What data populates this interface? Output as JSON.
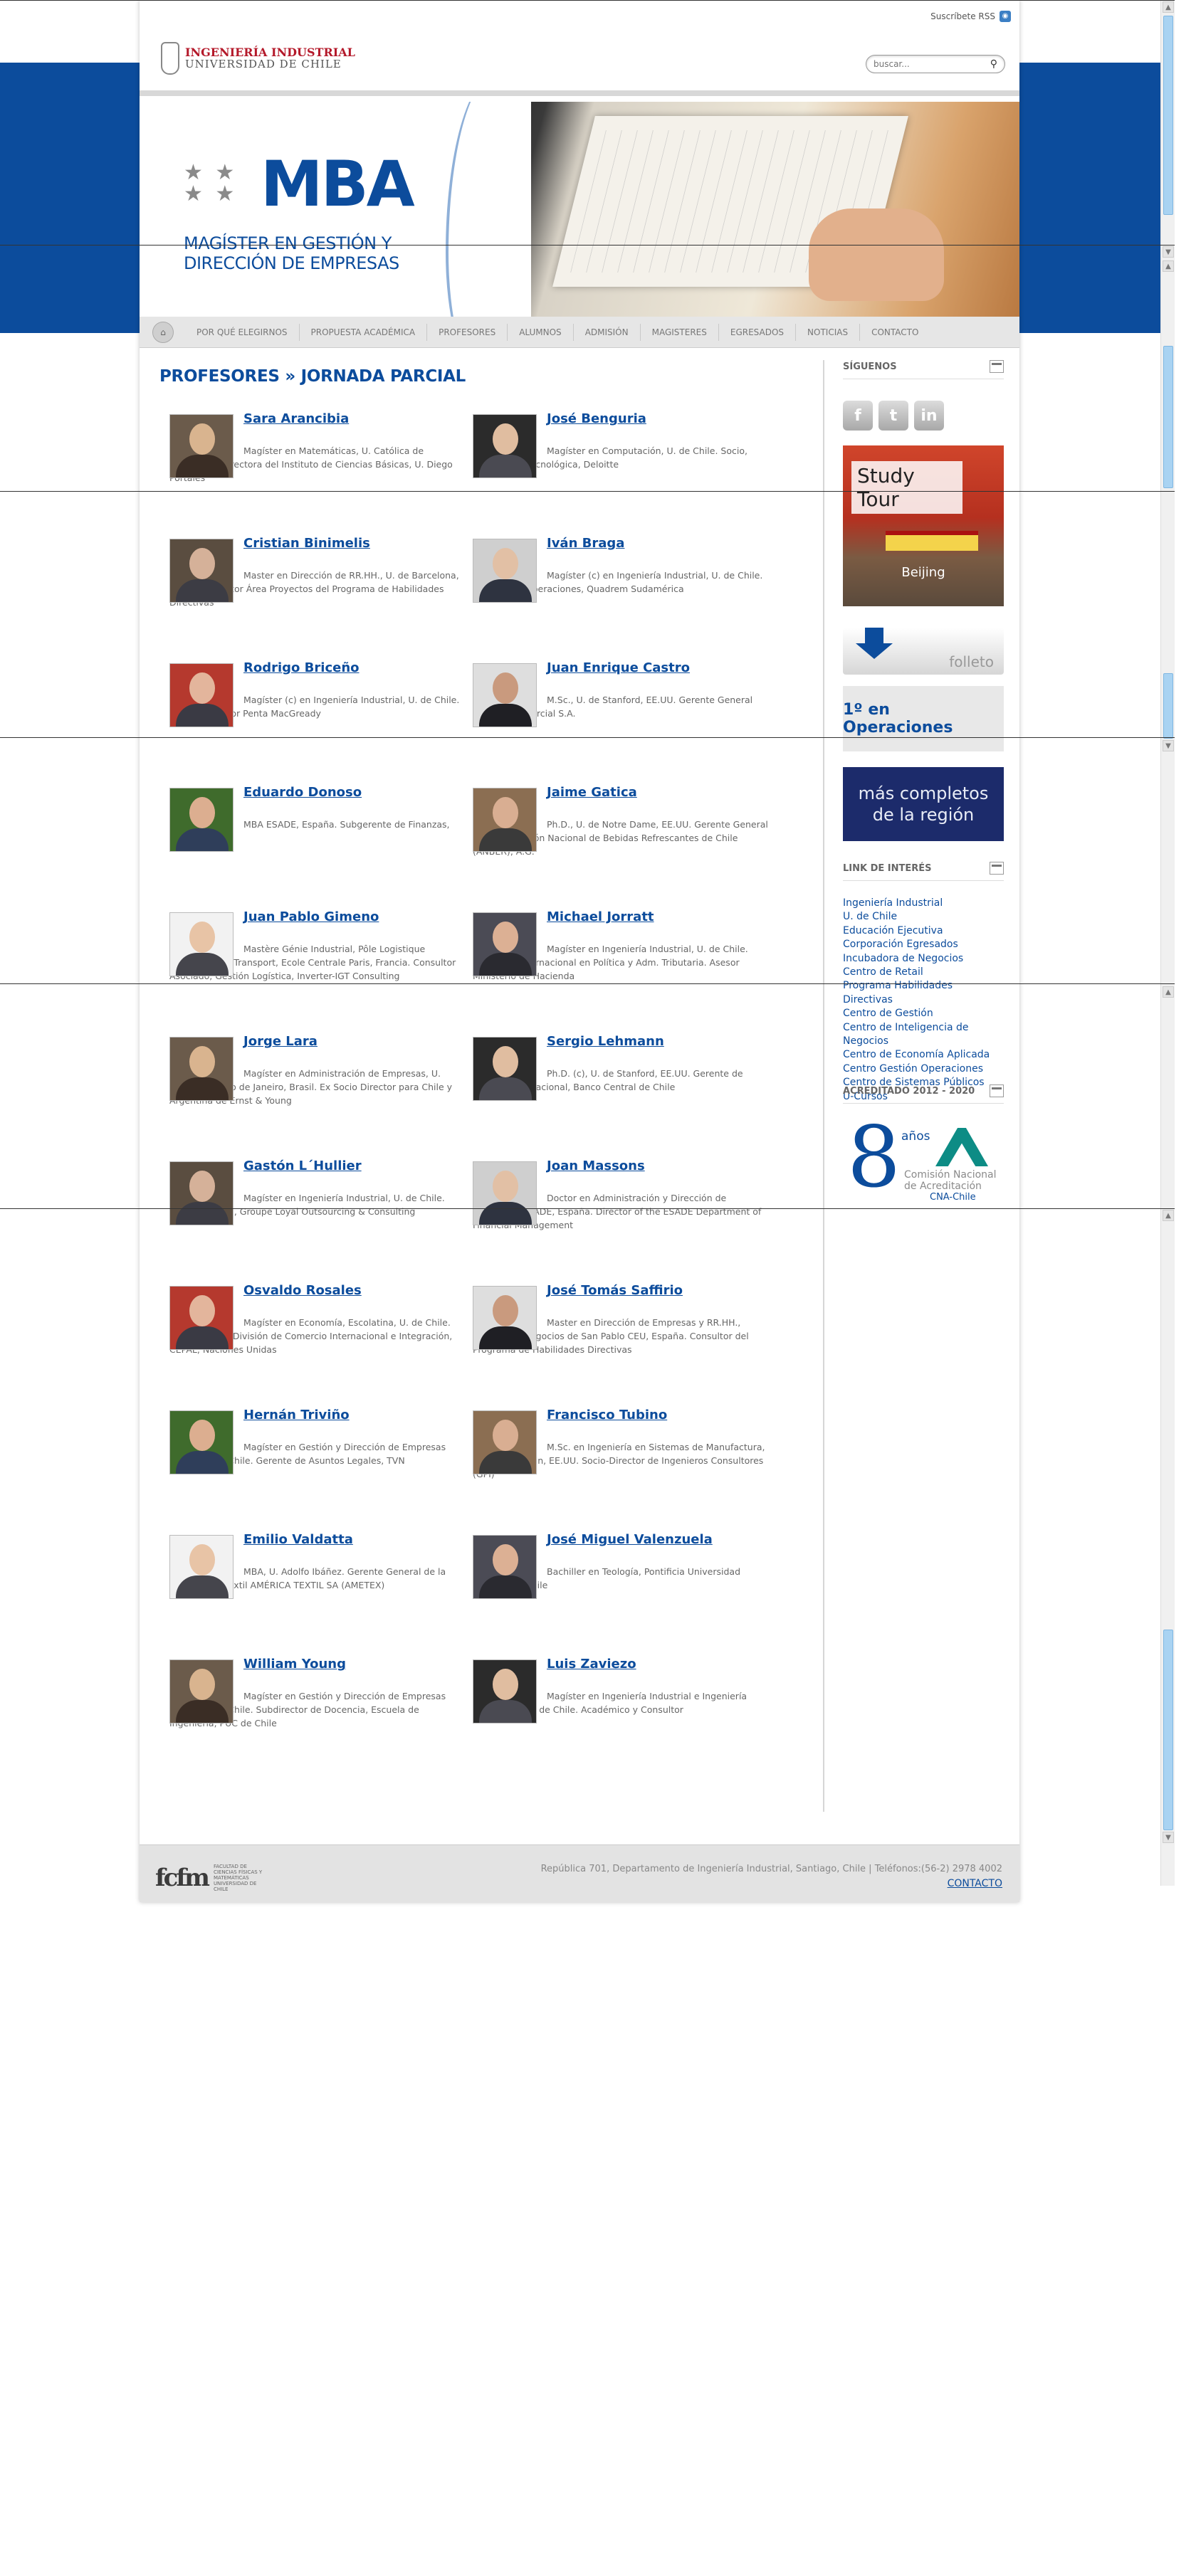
{
  "header": {
    "rss_label": "Suscríbete RSS",
    "logo_line1": "INGENIERÍA INDUSTRIAL",
    "logo_line2": "UNIVERSIDAD DE CHILE",
    "search_placeholder": "buscar..."
  },
  "banner": {
    "title": "MBA",
    "subtitle_line1": "MAGÍSTER EN GESTIÓN Y",
    "subtitle_line2": "DIRECCIÓN DE EMPRESAS"
  },
  "nav": {
    "items": [
      "POR QUÉ ELEGIRNOS",
      "PROPUESTA ACADÉMICA",
      "PROFESORES",
      "ALUMNOS",
      "ADMISIÓN",
      "MAGISTERES",
      "EGRESADOS",
      "NOTICIAS",
      "CONTACTO"
    ]
  },
  "main": {
    "heading": "PROFESORES » JORNADA PARCIAL",
    "professors": [
      {
        "name": "Sara Arancibia",
        "desc": "Magíster en Matemáticas, U. Católica de Valparaíso. Directora del Instituto de Ciencias Básicas, U. Diego Portales"
      },
      {
        "name": "José Benguria",
        "desc": "Magíster en Computación, U. de Chile. Socio, Consultoría Tecnológica, Deloitte"
      },
      {
        "name": "Cristian Binimelis",
        "desc": "Master en Dirección de RR.HH., U. de Barcelona, España. Director Área Proyectos del Programa de Habilidades Directivas"
      },
      {
        "name": "Iván Braga",
        "desc": "Magíster (c) en Ingeniería Industrial, U. de Chile. Director de Operaciones, Quadrem Sudamérica"
      },
      {
        "name": "Rodrigo Briceño",
        "desc": "Magíster (c) en Ingeniería Industrial, U. de Chile. Socio y Director Penta MacGready"
      },
      {
        "name": "Juan Enrique Castro",
        "desc": "M.Sc., U. de Stanford, EE.UU. Gerente General Salfavel Comercial S.A."
      },
      {
        "name": "Eduardo Donoso",
        "desc": "MBA ESADE, España. Subgerente de Finanzas, COPEC S.A."
      },
      {
        "name": "Jaime Gatica",
        "desc": "Ph.D., U. de Notre Dame, EE.UU. Gerente General de la Asociación Nacional de Bebidas Refrescantes de Chile (ANBER), A.G."
      },
      {
        "name": "Juan Pablo Gimeno",
        "desc": "Mastère Génie Industrial, Pôle Logistique Industrielle et Transport, Ecole Centrale Paris, Francia. Consultor Asociado, Gestión Logística, Inverter-IGT Consulting"
      },
      {
        "name": "Michael Jorratt",
        "desc": "Magíster en Ingeniería Industrial, U. de Chile. Consultor Internacional en Política y Adm. Tributaria. Asesor Ministerio de Hacienda"
      },
      {
        "name": "Jorge Lara",
        "desc": "Magíster en Administración de Empresas, U. Católica de Río de Janeiro, Brasil. Ex Socio Director para Chile y Argentina de Ernst & Young"
      },
      {
        "name": "Sergio Lehmann",
        "desc": "Ph.D. (c), U. de Stanford, EE.UU. Gerente de Análisis Internacional, Banco Central de Chile"
      },
      {
        "name": "Gastón L´Hullier",
        "desc": "Magíster en Ingeniería Industrial, U. de Chile. Socio Principal, Groupe Loyal Outsourcing & Consulting"
      },
      {
        "name": "Joan Massons",
        "desc": "Doctor en Administración y Dirección de Empresas, ESADE, España. Director of the ESADE Department of Financial Management"
      },
      {
        "name": "Osvaldo Rosales",
        "desc": "Magíster en Economía, Escolatina, U. de Chile. Director de la División de Comercio Internacional e Integración, CEPAL, Naciones Unidas"
      },
      {
        "name": "José Tomás Saffirio",
        "desc": "Master en Dirección de Empresas y RR.HH., Escuela de Negocios de San Pablo CEU, España. Consultor del Programa de Habilidades Directivas"
      },
      {
        "name": "Hernán Triviño",
        "desc": "Magíster en Gestión y Dirección de Empresas (MBA), U. de Chile. Gerente de Asuntos Legales, TVN"
      },
      {
        "name": "Francisco Tubino",
        "desc": "M.Sc. en Ingeniería en Sistemas de Manufactura, U. de Wisconsin, EE.UU. Socio-Director de Ingenieros Consultores (GPI)"
      },
      {
        "name": "Emilio Valdatta",
        "desc": "MBA, U. Adolfo Ibáñez. Gerente General de la corporación textil AMÉRICA TEXTIL SA (AMETEX)"
      },
      {
        "name": "José Miguel Valenzuela",
        "desc": "Bachiller en Teología, Pontificia Universidad Católica de Chile"
      },
      {
        "name": "William Young",
        "desc": "Magíster en Gestión y Dirección de Empresas (MBA), U. de Chile. Subdirector de Docencia, Escuela de Ingeniería, PUC de Chile"
      },
      {
        "name": "Luis Zaviezo",
        "desc": "Magíster en Ingeniería Industrial e Ingeniería Económica, U. de Chile. Académico y Consultor"
      }
    ]
  },
  "sidebar": {
    "follow_title": "SÍGUENOS",
    "social": [
      {
        "icon": "facebook-icon",
        "glyph": "f"
      },
      {
        "icon": "twitter-icon",
        "glyph": "t"
      },
      {
        "icon": "linkedin-icon",
        "glyph": "in"
      }
    ],
    "study_tour_label": "Study Tour",
    "study_tour_city": "Beijing",
    "folleto_label": "folleto",
    "ops_label": "1º en Operaciones",
    "region_line1": "más completos",
    "region_line2": "de la región",
    "links_title": "LINK DE INTERÉS",
    "links": [
      "Ingeniería Industrial",
      "U. de Chile",
      "Educación Ejecutiva",
      "Corporación Egresados",
      "Incubadora de Negocios",
      "Centro de Retail",
      "Programa Habilidades Directivas",
      "Centro de Gestión",
      "Centro de Inteligencia de Negocios",
      "Centro de Economía Aplicada",
      "Centro Gestión Operaciones",
      "Centro de Sistemas Públicos",
      "U-Cursos"
    ],
    "accred_title": "ACREDITADO 2012 - 2020",
    "accred_number": "8",
    "accred_years": "años",
    "accred_org_line1": "Comisión Nacional",
    "accred_org_line2": "de Acreditación",
    "accred_org_short": "CNA-Chile"
  },
  "footer": {
    "logo": "fcfm",
    "logo_text": "FACULTAD DE CIENCIAS FÍSICAS Y MATEMÁTICAS UNIVERSIDAD DE CHILE",
    "address": "República 701, Departamento de Ingeniería Industrial, Santiago, Chile | Teléfonos:(56-2) 2978 4002",
    "contact": "CONTACTO"
  },
  "colors": {
    "brand_blue": "#0c4c9c",
    "logo_red": "#b4192a"
  }
}
